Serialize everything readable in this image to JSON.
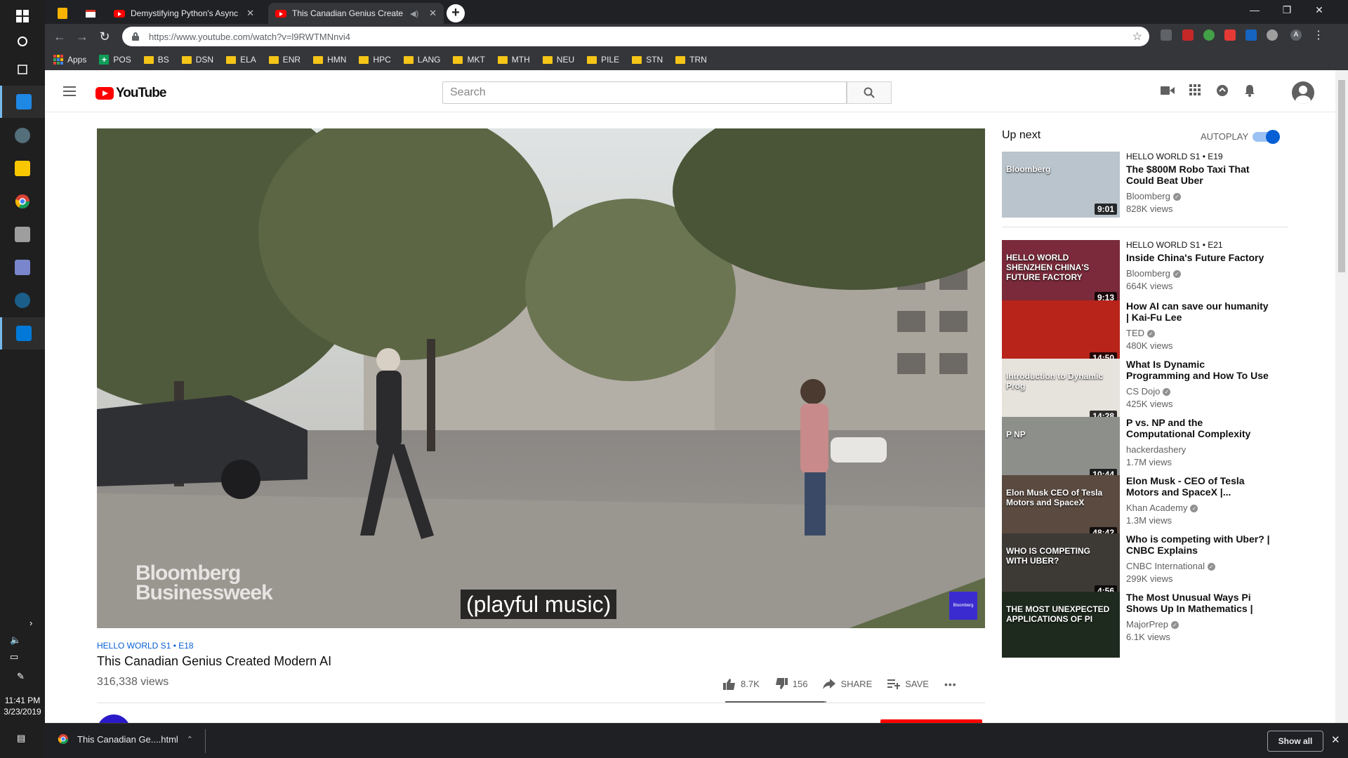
{
  "taskbar": {
    "time": "11:41 PM",
    "date": "3/23/2019"
  },
  "browser": {
    "tabs": [
      {
        "label": "Demystifying Python's Async and"
      },
      {
        "label": "This Canadian Genius Create"
      }
    ],
    "url": "https://www.youtube.com/watch?v=l9RWTMNnvi4",
    "bookmarks": [
      "Apps",
      "POS",
      "BS",
      "DSN",
      "ELA",
      "ENR",
      "HMN",
      "HPC",
      "LANG",
      "MKT",
      "MTH",
      "NEU",
      "PILE",
      "STN",
      "TRN"
    ]
  },
  "youtube": {
    "logo_text": "YouTube",
    "search_placeholder": "Search",
    "video": {
      "caption": "(playful music)",
      "watermark_line1": "Bloomberg",
      "watermark_line2": "Businessweek",
      "badge": "Bloomberg",
      "series": "HELLO WORLD  S1 • E18",
      "title": "This Canadian Genius Created Modern AI",
      "views": "316,338 views",
      "likes": "8.7K",
      "dislikes": "156",
      "like_ratio": 0.98,
      "share_label": "SHARE",
      "save_label": "SAVE",
      "more": "•••"
    },
    "sidebar": {
      "up_next": "Up next",
      "autoplay": "AUTOPLAY",
      "autoplay_on": true,
      "items": [
        {
          "series": "HELLO WORLD  S1 • E19",
          "title": "The $800M Robo Taxi That Could Beat Uber",
          "channel": "Bloomberg",
          "views": "828K views",
          "duration": "9:01",
          "thumb_text": "Bloomberg",
          "thumb_color": "#b9c4cc"
        },
        {
          "series": "HELLO WORLD  S1 • E21",
          "title": "Inside China's Future Factory",
          "channel": "Bloomberg",
          "views": "664K views",
          "duration": "9:13",
          "thumb_text": "HELLO WORLD SHENZHEN CHINA'S FUTURE FACTORY",
          "thumb_color": "#7a2a3a"
        },
        {
          "series": "",
          "title": "How AI can save our humanity | Kai-Fu Lee",
          "channel": "TED",
          "views": "480K views",
          "duration": "14:50",
          "thumb_text": "",
          "thumb_color": "#b8241a"
        },
        {
          "series": "",
          "title": "What Is Dynamic Programming and How To Use It",
          "channel": "CS Dojo",
          "views": "425K views",
          "duration": "14:28",
          "thumb_text": "Introduction to Dynamic Prog",
          "thumb_color": "#e6e2dc"
        },
        {
          "series": "",
          "title": "P vs. NP and the Computational Complexity Zoo",
          "channel": "hackerdashery",
          "views": "1.7M views",
          "duration": "10:44",
          "thumb_text": "P  NP",
          "thumb_color": "#8d8f8b"
        },
        {
          "series": "",
          "title": "Elon Musk - CEO of Tesla Motors and SpaceX |...",
          "channel": "Khan Academy",
          "views": "1.3M views",
          "duration": "48:42",
          "thumb_text": "Elon Musk CEO of Tesla Motors and SpaceX",
          "thumb_color": "#5a4a40"
        },
        {
          "series": "",
          "title": "Who is competing with Uber? | CNBC Explains",
          "channel": "CNBC International",
          "views": "299K views",
          "duration": "4:56",
          "thumb_text": "WHO IS COMPETING WITH UBER?",
          "thumb_color": "#3d3a36"
        },
        {
          "series": "",
          "title": "The Most Unusual Ways Pi Shows Up In Mathematics | Ca...",
          "channel": "MajorPrep",
          "views": "6.1K views",
          "duration": "",
          "thumb_text": "THE MOST UNEXPECTED APPLICATIONS OF PI",
          "thumb_color": "#1e2a1e"
        }
      ]
    }
  },
  "downloads": {
    "file": "This Canadian Ge....html",
    "show_all": "Show all"
  }
}
